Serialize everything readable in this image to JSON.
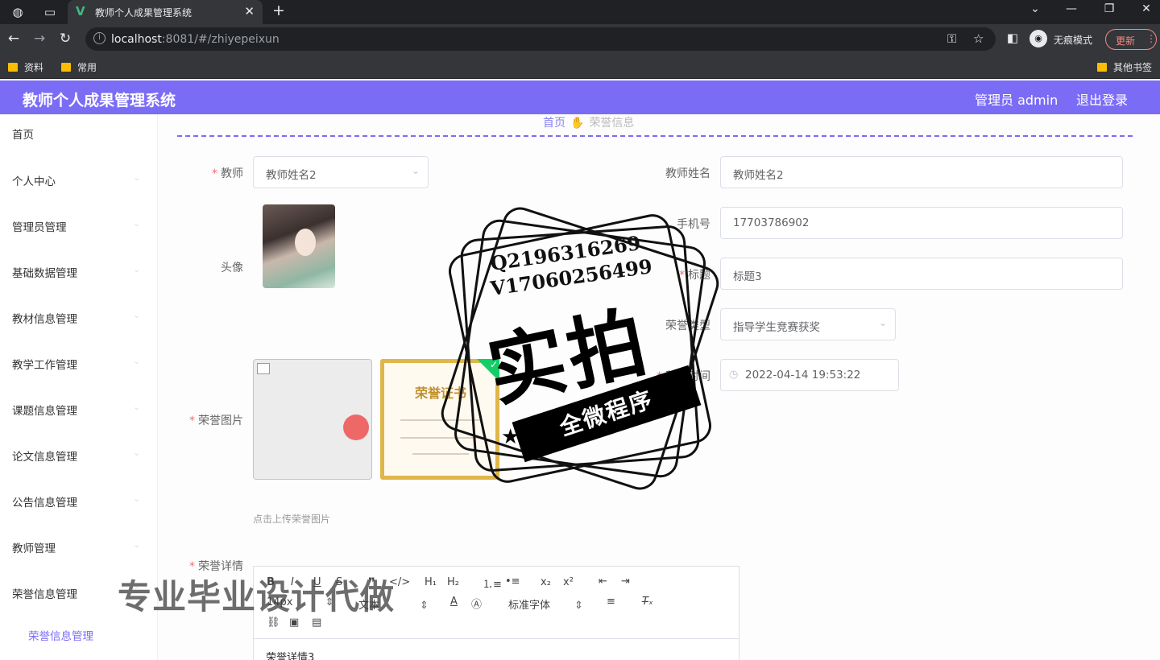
{
  "browser": {
    "tab_title": "教师个人成果管理系统",
    "url_host": "localhost",
    "url_rest": ":8081/#/zhiyepeixun",
    "profile_label": "无痕模式",
    "update_label": "更新",
    "bookmarks": [
      "资料",
      "常用"
    ],
    "other_bookmarks": "其他书签"
  },
  "header": {
    "title": "教师个人成果管理系统",
    "admin": "管理员 admin",
    "logout": "退出登录"
  },
  "sidebar": {
    "items": [
      "首页",
      "个人中心",
      "管理员管理",
      "基础数据管理",
      "教材信息管理",
      "教学工作管理",
      "课题信息管理",
      "论文信息管理",
      "公告信息管理",
      "教师管理",
      "荣誉信息管理"
    ],
    "sub_item": "荣誉信息管理"
  },
  "breadcrumb": {
    "home": "首页",
    "current": "荣誉信息"
  },
  "form": {
    "teacher_label": "教师",
    "teacher_value": "教师姓名2",
    "teacher_name_label": "教师姓名",
    "teacher_name_value": "教师姓名2",
    "avatar_label": "头像",
    "phone_label": "手机号",
    "phone_value": "17703786902",
    "title_label": "标题",
    "title_value": "标题3",
    "honor_type_label": "荣誉类型",
    "honor_type_value": "指导学生竞赛获奖",
    "award_time_label": "获奖时间",
    "award_time_value": "2022-04-14 19:53:22",
    "honor_image_label": "荣誉图片",
    "cert_title": "荣誉证书",
    "upload_hint": "点击上传荣誉图片",
    "honor_detail_label": "荣誉详情",
    "editor": {
      "size_select": "14px",
      "text_select": "文本",
      "font_select": "标准字体",
      "content": "荣誉详情3"
    }
  },
  "watermark": {
    "line1": "Q2196316269",
    "line2": "V17060256499",
    "big": "实拍",
    "ribbon": "全微程序",
    "bottom": "专业毕业设计代做"
  }
}
